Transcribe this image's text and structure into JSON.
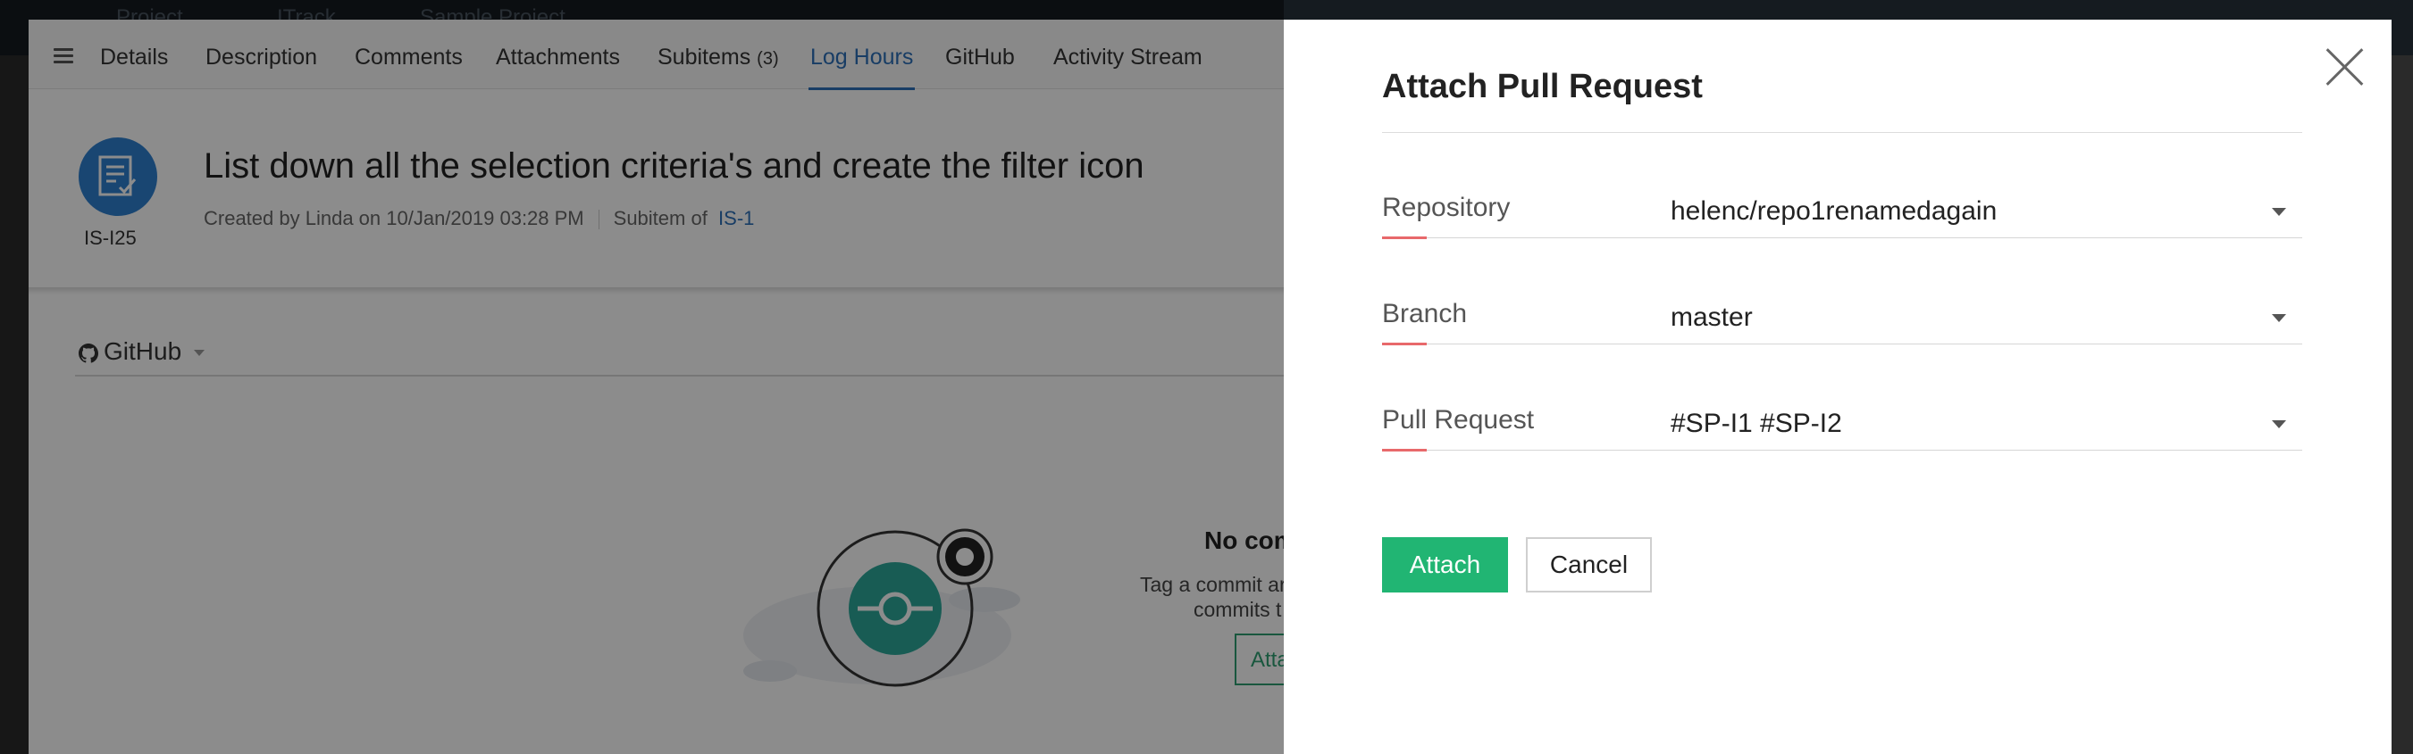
{
  "topbar": {
    "crumb1": "Project",
    "crumb2": "ITrack",
    "crumb3": "Sample Project"
  },
  "tabs": [
    {
      "label": "Details"
    },
    {
      "label": "Description"
    },
    {
      "label": "Comments"
    },
    {
      "label": "Attachments"
    },
    {
      "label": "Subitems",
      "count": "(3)"
    },
    {
      "label": "Log Hours",
      "active": true
    },
    {
      "label": "GitHub"
    },
    {
      "label": "Activity Stream"
    }
  ],
  "issue": {
    "id": "IS-I25",
    "title": "List down all the selection criteria's and create the filter icon",
    "created": "Created by Linda on 10/Jan/2019 03:28 PM",
    "subitem_of_label": "Subitem of",
    "parent": "IS-1"
  },
  "github": {
    "header": "GitHub",
    "empty_title": "No com",
    "empty_desc_line1": "Tag a commit ar",
    "empty_desc_line2": "commits t",
    "empty_button": "Atta"
  },
  "dialog": {
    "title": "Attach Pull Request",
    "fields": [
      {
        "label": "Repository",
        "value": "helenc/repo1renamedagain"
      },
      {
        "label": "Branch",
        "value": "master"
      },
      {
        "label": "Pull Request",
        "value": "#SP-I1 #SP-I2"
      }
    ],
    "attach_label": "Attach",
    "cancel_label": "Cancel"
  },
  "colors": {
    "accent_green": "#21b573",
    "accent_blue": "#2d6fb8",
    "field_accent": "#e8696b"
  }
}
